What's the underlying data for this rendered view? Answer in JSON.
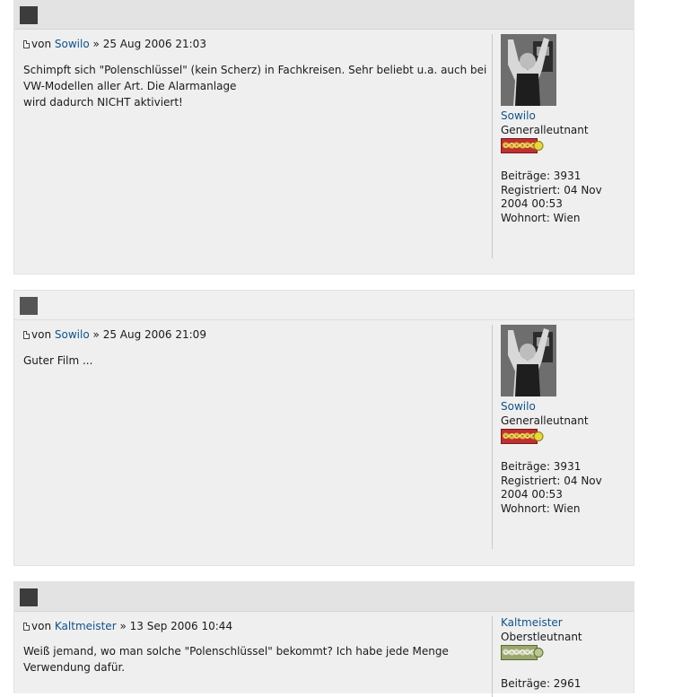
{
  "colors": {
    "link": "#105289",
    "header_square_dark": "#555555",
    "header_square_darker": "#3c3c3c"
  },
  "posts": [
    {
      "author": "Sowilo",
      "by": "von",
      "sep": "»",
      "date": "25 Aug 2006 21:03",
      "content_lines": [
        "Schimpft sich \"Polenschlüssel\" (kein Scherz) in Fachkreisen. Sehr beliebt u.a. auch bei",
        "VW-Modellen aller Art. Die Alarmanlage",
        "wird dadurch NICHT aktiviert!"
      ],
      "profile": {
        "name": "Sowilo",
        "rank": "Generalleutnant",
        "rank_icon": "general-rank-insignia-icon",
        "beitraege": "Beiträge: 3931",
        "registriert_1": "Registriert: 04 Nov",
        "registriert_2": "2004 00:53",
        "wohnort": "Wohnort: Wien"
      }
    },
    {
      "author": "Sowilo",
      "by": "von",
      "sep": "»",
      "date": "25 Aug 2006 21:09",
      "content_lines": [
        "Guter Film ..."
      ],
      "profile": {
        "name": "Sowilo",
        "rank": "Generalleutnant",
        "rank_icon": "general-rank-insignia-icon",
        "beitraege": "Beiträge: 3931",
        "registriert_1": "Registriert: 04 Nov",
        "registriert_2": "2004 00:53",
        "wohnort": "Wohnort: Wien"
      }
    },
    {
      "author": "Kaltmeister",
      "by": "von",
      "sep": "»",
      "date": "13 Sep 2006 10:44",
      "content_lines": [
        "Weiß jemand, wo man solche \"Polenschlüssel\" bekommt? Ich habe jede Menge",
        "Verwendung dafür."
      ],
      "profile": {
        "name": "Kaltmeister",
        "rank": "Oberstleutnant",
        "rank_icon": "officer-rank-insignia-icon",
        "beitraege": "Beiträge: 2961"
      }
    }
  ]
}
